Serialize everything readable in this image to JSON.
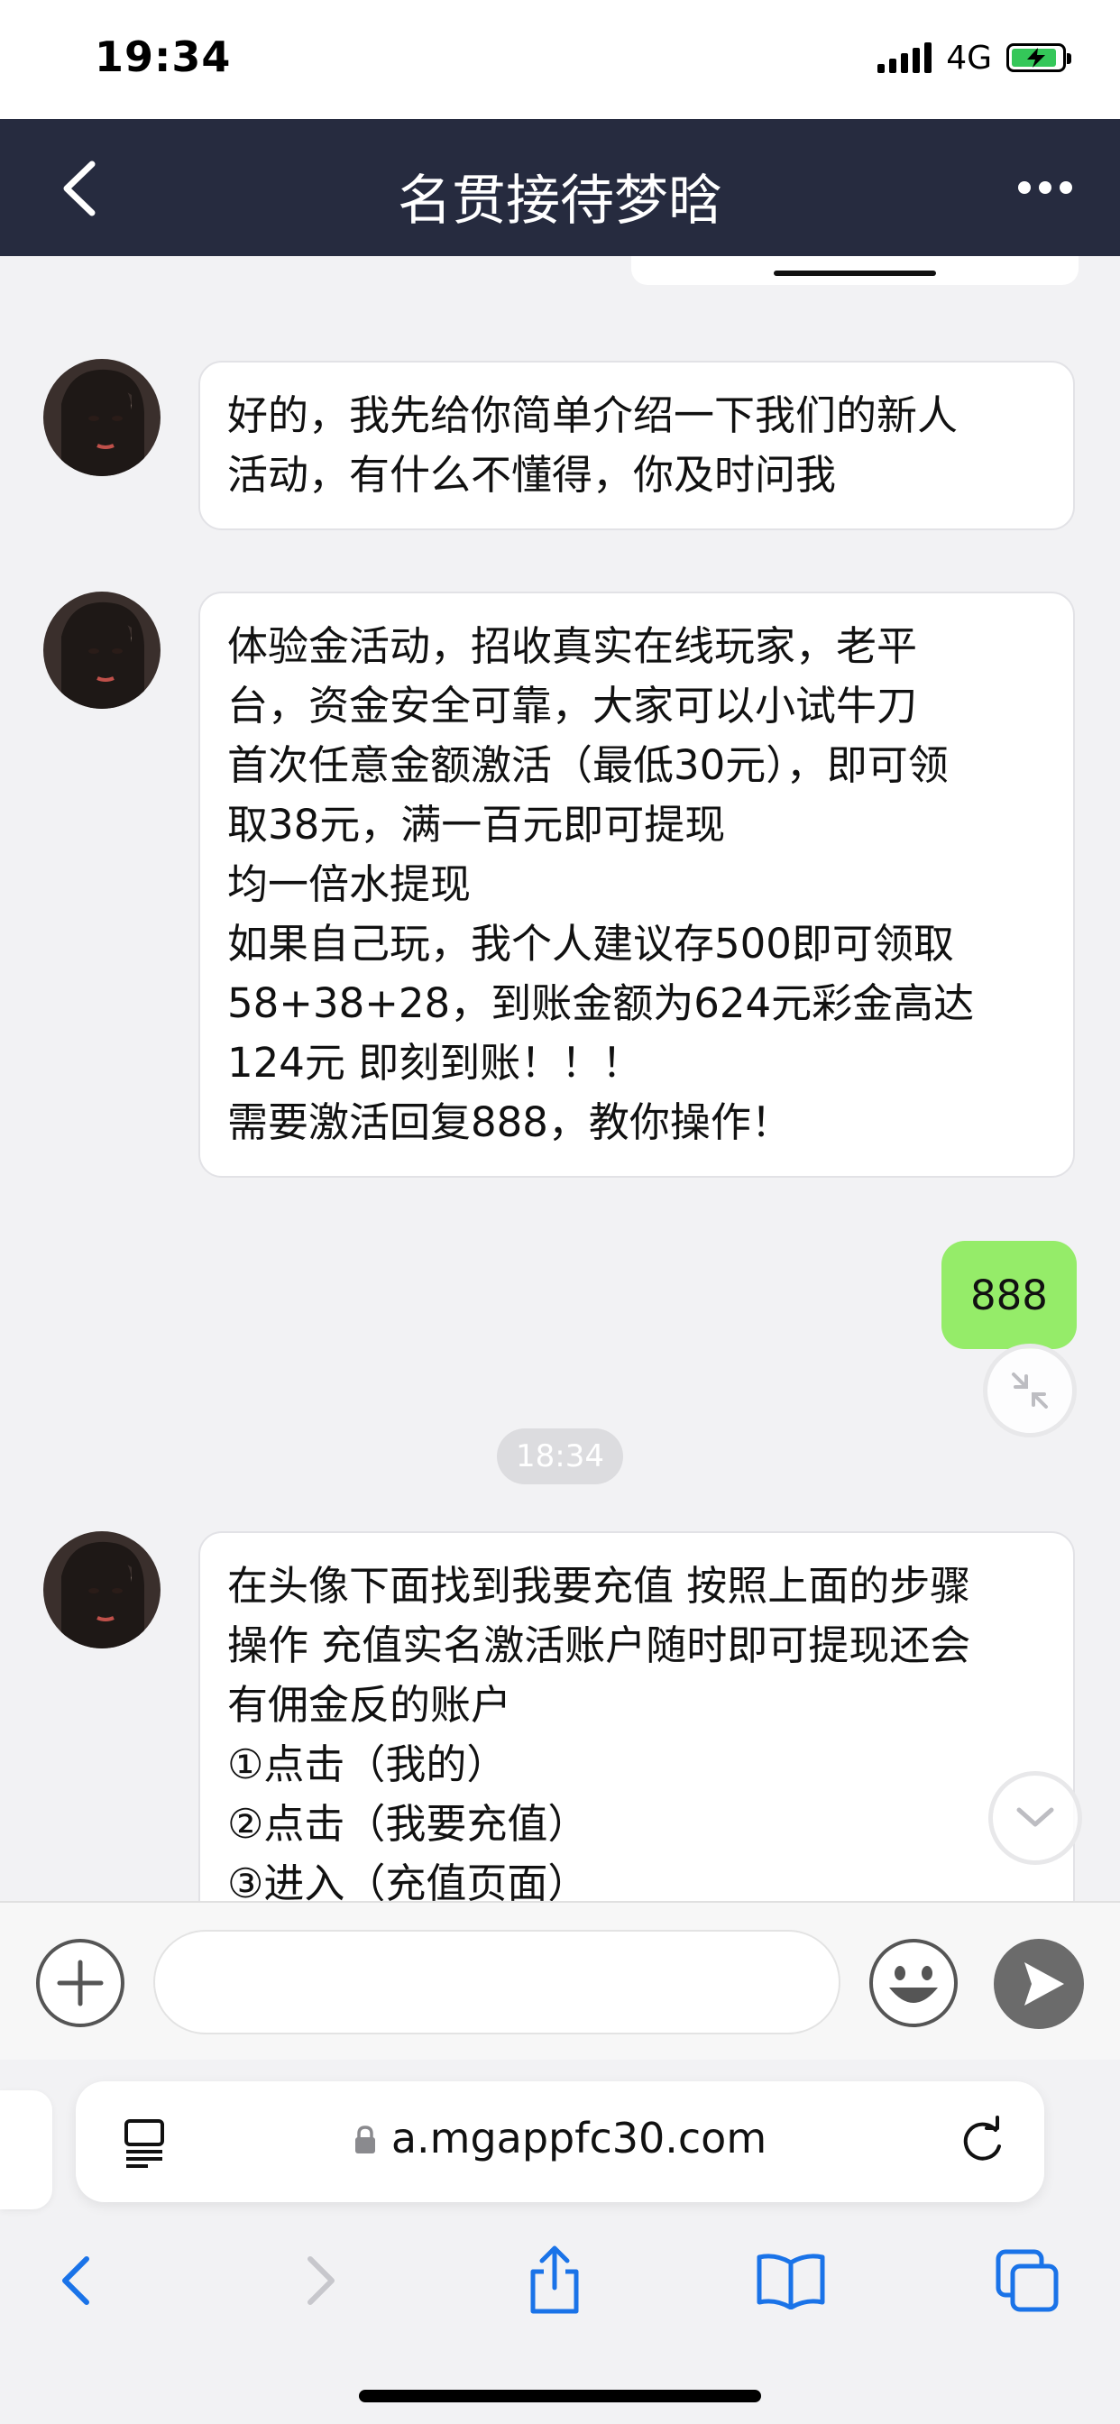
{
  "status_bar": {
    "time": "19:34",
    "network": "4G",
    "battery_level": 0.9,
    "battery_color": "#34c759"
  },
  "header": {
    "title": "名贯接待梦晗",
    "back_icon": "chevron-left-icon",
    "more_icon": "more-dots-icon",
    "background": "#262b3f"
  },
  "messages": [
    {
      "side": "incoming",
      "lines": [
        "好的，我先给你简单介绍一下我们的新人",
        "活动，有什么不懂得，你及时问我"
      ]
    },
    {
      "side": "incoming",
      "lines": [
        "体验金活动，招收真实在线玩家，老平",
        "台，资金安全可靠，大家可以小试牛刀",
        "首次任意金额激活（最低30元），即可领",
        "取38元，满一百元即可提现",
        "均一倍水提现",
        "如果自己玩，我个人建议存500即可领取",
        "58+38+28，到账金额为624元彩金高达",
        "124元 即刻到账！！！",
        "需要激活回复888，教你操作！"
      ]
    },
    {
      "side": "outgoing",
      "text": "888",
      "color": "#95ec69"
    },
    {
      "side": "timestamp",
      "text": "18:34"
    },
    {
      "side": "incoming",
      "lines": [
        "在头像下面找到我要充值 按照上面的步骤",
        "操作 充值实名激活账户随时即可提现还会",
        "有佣金反的账户",
        "①点击（我的）",
        "②点击（我要充值）",
        "③进入（充值页面）"
      ]
    }
  ],
  "floating_icons": {
    "collapse": "collapse-arrows-icon",
    "scroll_down": "chevron-down-icon"
  },
  "input_bar": {
    "placeholder": "",
    "plus_icon": "plus-circle-icon",
    "emoji_icon": "emoji-smile-icon",
    "send_icon": "send-arrow-icon"
  },
  "browser": {
    "url": "a.mgappfc30.com",
    "reader_icon": "reader-view-icon",
    "lock_icon": "lock-icon",
    "reload_icon": "reload-icon",
    "toolbar": [
      "back-arrow-icon",
      "forward-arrow-icon",
      "share-icon",
      "bookmarks-book-icon",
      "tabs-icon"
    ]
  }
}
